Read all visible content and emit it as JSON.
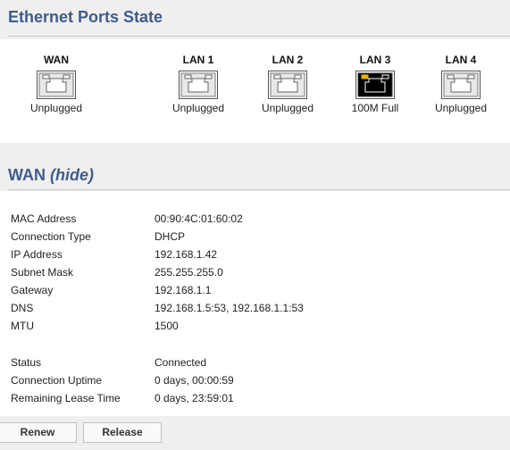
{
  "ports_section": {
    "title": "Ethernet Ports State"
  },
  "ports": [
    {
      "label": "WAN",
      "state": "Unplugged",
      "connected": false,
      "icon": "ethernet-port-icon"
    },
    {
      "label": "LAN 1",
      "state": "Unplugged",
      "connected": false,
      "icon": "ethernet-port-icon"
    },
    {
      "label": "LAN 2",
      "state": "Unplugged",
      "connected": false,
      "icon": "ethernet-port-icon"
    },
    {
      "label": "LAN 3",
      "state": "100M Full",
      "connected": true,
      "icon": "ethernet-port-icon"
    },
    {
      "label": "LAN 4",
      "state": "Unplugged",
      "connected": false,
      "icon": "ethernet-port-icon"
    }
  ],
  "wan_section": {
    "title": "WAN",
    "hide_label": "(hide)"
  },
  "wan_info": [
    {
      "label": "MAC Address",
      "value": "00:90:4C:01:60:02"
    },
    {
      "label": "Connection Type",
      "value": "DHCP"
    },
    {
      "label": "IP Address",
      "value": "192.168.1.42"
    },
    {
      "label": "Subnet Mask",
      "value": "255.255.255.0"
    },
    {
      "label": "Gateway",
      "value": "192.168.1.1"
    },
    {
      "label": "DNS",
      "value": "192.168.1.5:53, 192.168.1.1:53"
    },
    {
      "label": "MTU",
      "value": "1500"
    }
  ],
  "wan_status": [
    {
      "label": "Status",
      "value": "Connected"
    },
    {
      "label": "Connection Uptime",
      "value": "0 days, 00:00:59"
    },
    {
      "label": "Remaining Lease Time",
      "value": "0 days, 23:59:01"
    }
  ],
  "buttons": {
    "renew": "Renew",
    "release": "Release"
  },
  "colors": {
    "heading": "#405c8a",
    "section_bg": "#efefef",
    "port_connected_body": "#000000",
    "port_link_led": "#f0b400",
    "port_unplugged_body": "#e8e8e8"
  }
}
